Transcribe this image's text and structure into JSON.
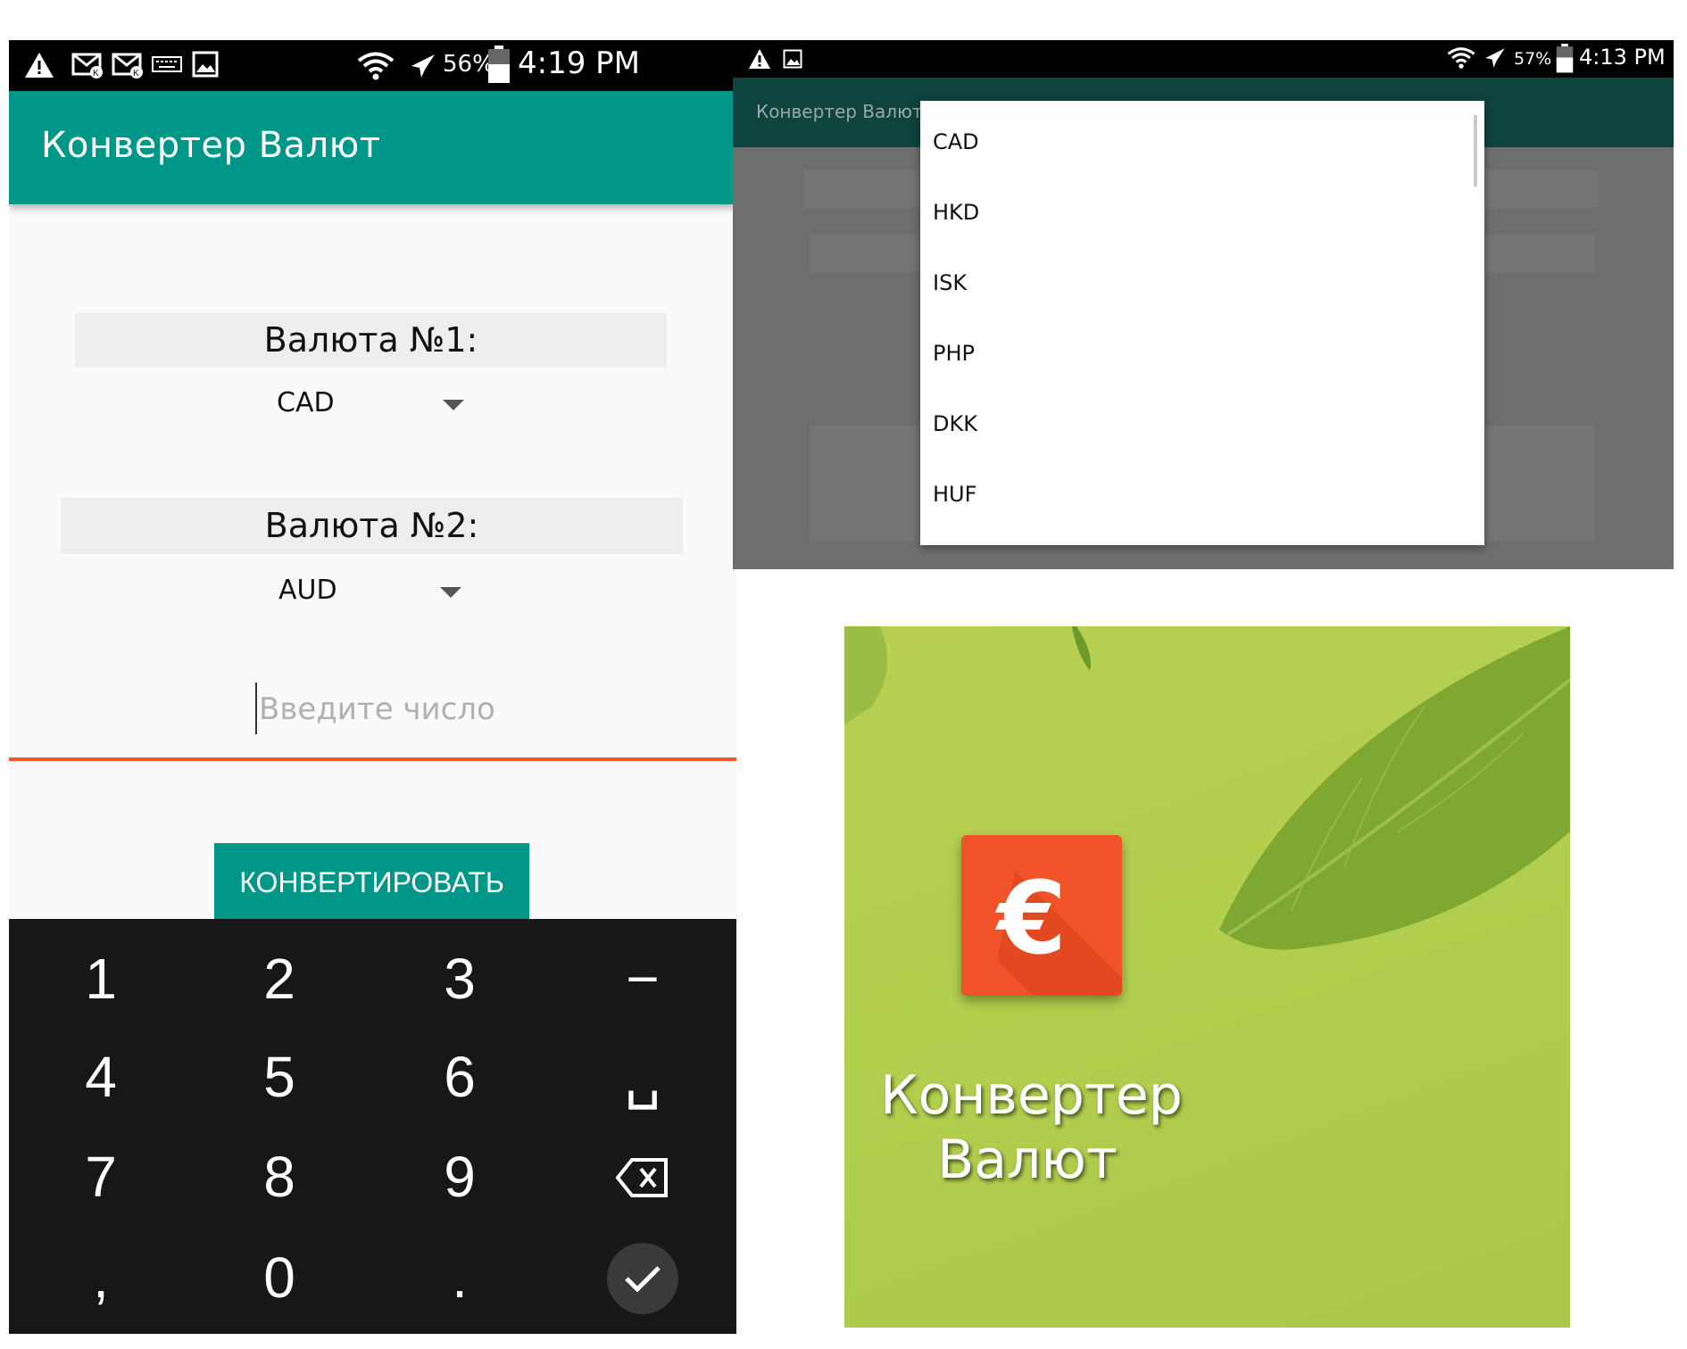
{
  "app_title": "Конвертер Валют",
  "converter_screen": {
    "status_bar": {
      "battery": "56%",
      "time": "4:19 PM"
    },
    "currency1": {
      "label": "Валюта №1:",
      "selected": "CAD"
    },
    "currency2": {
      "label": "Валюта №2:",
      "selected": "AUD"
    },
    "amount_input": {
      "placeholder": "Введите число",
      "value": ""
    },
    "convert_button": "КОНВЕРТИРОВАТЬ",
    "keypad": {
      "keys": [
        "1",
        "2",
        "3",
        "−",
        "4",
        "5",
        "6",
        "␣",
        "7",
        "8",
        "9",
        "⌫",
        ",",
        "0",
        ".",
        "✓"
      ]
    }
  },
  "dropdown_screen": {
    "status_bar": {
      "battery": "57%",
      "time": "4:13 PM"
    },
    "options": [
      "CAD",
      "HKD",
      "ISK",
      "PHP",
      "DKK",
      "HUF"
    ]
  },
  "launcher_tile": {
    "icon_symbol": "€",
    "label_line1": "Конвертер",
    "label_line2": "Валют"
  },
  "colors": {
    "primary": "#009688",
    "accent": "#f05a28",
    "icon_bg": "#f0532a",
    "tile_bg": "#b3cf4e"
  },
  "icons": [
    "warning-icon",
    "mail-icon",
    "keyboard-icon",
    "image-icon",
    "wifi-icon",
    "airplane-icon",
    "battery-icon",
    "euro-icon",
    "backspace-icon",
    "check-icon"
  ]
}
